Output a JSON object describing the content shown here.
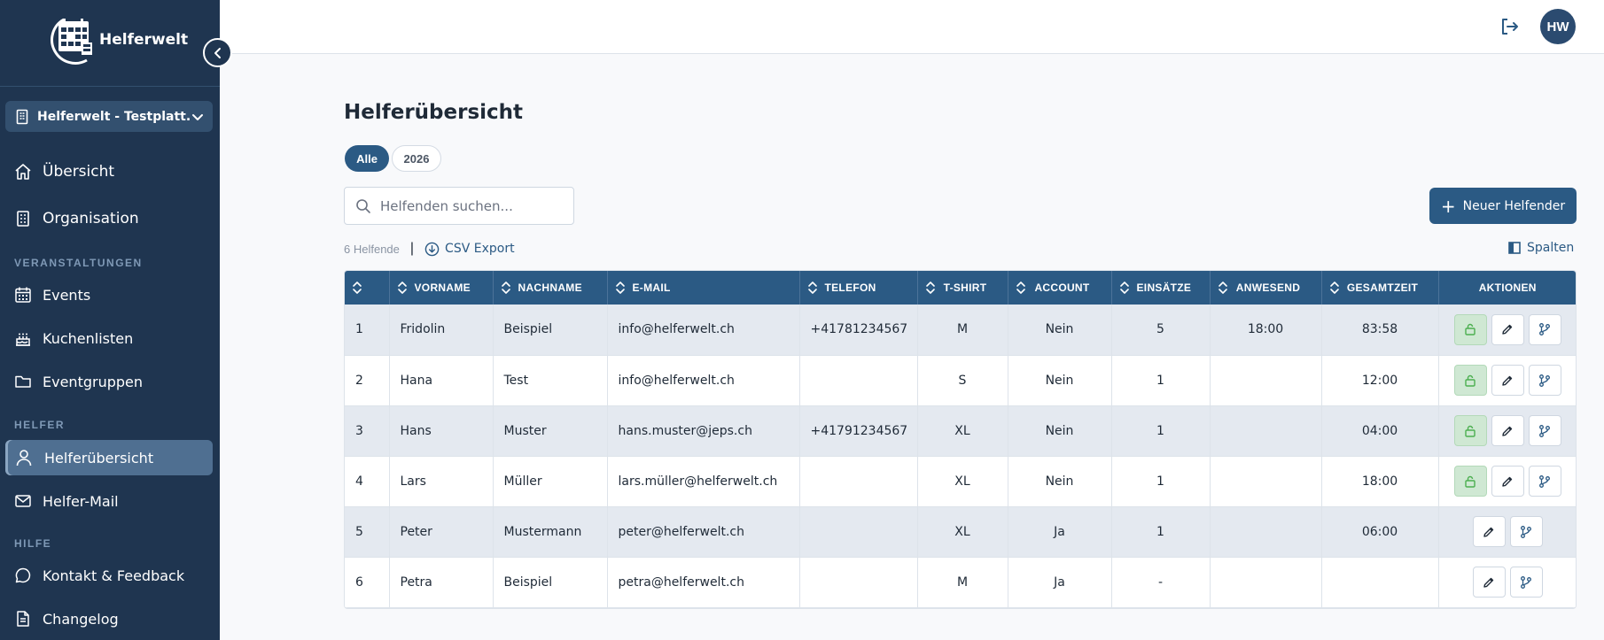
{
  "app": {
    "brand": "Helferwelt"
  },
  "sidebar": {
    "org_name": "Helferwelt - Testplatt...",
    "main_items": [
      {
        "label": "Übersicht",
        "icon": "home-icon"
      },
      {
        "label": "Organisation",
        "icon": "building-icon"
      }
    ],
    "sections": {
      "events": "VERANSTALTUNGEN",
      "helpers": "HELFER",
      "help": "HILFE"
    },
    "event_items": [
      {
        "label": "Events",
        "icon": "calendar-icon"
      },
      {
        "label": "Kuchenlisten",
        "icon": "cake-icon"
      },
      {
        "label": "Eventgruppen",
        "icon": "folder-icon"
      }
    ],
    "helper_items": [
      {
        "label": "Helferübersicht",
        "icon": "user-icon",
        "active": true
      },
      {
        "label": "Helfer-Mail",
        "icon": "mail-icon"
      }
    ],
    "help_items": [
      {
        "label": "Kontakt & Feedback",
        "icon": "chat-icon"
      },
      {
        "label": "Changelog",
        "icon": "document-icon"
      }
    ]
  },
  "topbar": {
    "avatar_initials": "HW"
  },
  "page": {
    "title": "Helferübersicht",
    "filters": [
      "Alle",
      "2026"
    ],
    "search_placeholder": "Helfenden suchen...",
    "new_button": "Neuer Helfender",
    "count": "6 Helfende",
    "csv_export": "CSV Export",
    "columns_button": "Spalten"
  },
  "table": {
    "headers": [
      "",
      "VORNAME",
      "NACHNAME",
      "E-MAIL",
      "TELEFON",
      "T-SHIRT",
      "ACCOUNT",
      "EINSÄTZE",
      "ANWESEND",
      "GESAMTZEIT",
      "AKTIONEN"
    ],
    "rows": [
      {
        "nr": "1",
        "vorname": "Fridolin",
        "nachname": "Beispiel",
        "email": "info@helferwelt.ch",
        "telefon": "+41781234567",
        "tshirt": "M",
        "account": "Nein",
        "einsaetze": "5",
        "anwesend": "18:00",
        "gesamtzeit": "83:58",
        "unlock": true
      },
      {
        "nr": "2",
        "vorname": "Hana",
        "nachname": "Test",
        "email": "info@helferwelt.ch",
        "telefon": "",
        "tshirt": "S",
        "account": "Nein",
        "einsaetze": "1",
        "anwesend": "",
        "gesamtzeit": "12:00",
        "unlock": true
      },
      {
        "nr": "3",
        "vorname": "Hans",
        "nachname": "Muster",
        "email": "hans.muster@jeps.ch",
        "telefon": "+41791234567",
        "tshirt": "XL",
        "account": "Nein",
        "einsaetze": "1",
        "anwesend": "",
        "gesamtzeit": "04:00",
        "unlock": true
      },
      {
        "nr": "4",
        "vorname": "Lars",
        "nachname": "Müller",
        "email": "lars.müller@helferwelt.ch",
        "telefon": "",
        "tshirt": "XL",
        "account": "Nein",
        "einsaetze": "1",
        "anwesend": "",
        "gesamtzeit": "18:00",
        "unlock": true
      },
      {
        "nr": "5",
        "vorname": "Peter",
        "nachname": "Mustermann",
        "email": "peter@helferwelt.ch",
        "telefon": "",
        "tshirt": "XL",
        "account": "Ja",
        "einsaetze": "1",
        "anwesend": "",
        "gesamtzeit": "06:00",
        "unlock": false
      },
      {
        "nr": "6",
        "vorname": "Petra",
        "nachname": "Beispiel",
        "email": "petra@helferwelt.ch",
        "telefon": "",
        "tshirt": "M",
        "account": "Ja",
        "einsaetze": "-",
        "anwesend": "",
        "gesamtzeit": "",
        "unlock": false
      }
    ]
  },
  "colors": {
    "sidebar_bg": "#1f3550",
    "primary": "#2b5a84",
    "row_alt": "#e4e9f0",
    "unlock_green": "#cfe8d3"
  }
}
